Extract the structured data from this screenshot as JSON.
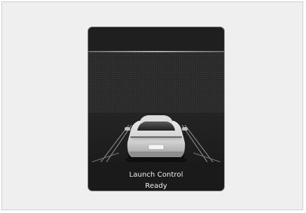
{
  "display": {
    "status_line1": "Launch Control",
    "status_line2": "Ready"
  },
  "colors": {
    "page_background": "#efefef",
    "screen_background": "#1e1e1e",
    "text": "#f2f2f2"
  },
  "icons": {
    "vehicle": "car-rear-view-icon",
    "lanes": "lane-lines-icon"
  }
}
